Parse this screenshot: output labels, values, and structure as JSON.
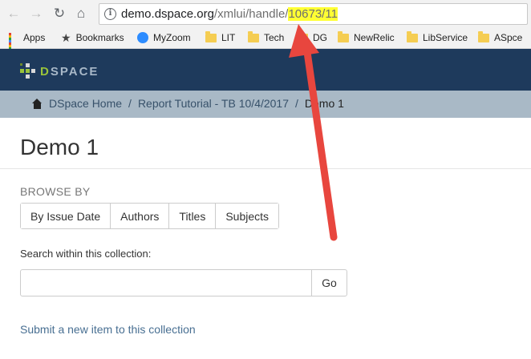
{
  "browser": {
    "url_host": "demo.dspace.org",
    "url_path": "/xmlui/handle/",
    "url_highlight": "10673/11",
    "bookmarks": [
      {
        "label": "Apps",
        "icon": "apps-grid-icon"
      },
      {
        "label": "Bookmarks",
        "icon": "star-icon"
      },
      {
        "label": "MyZoom",
        "icon": "zoom-icon"
      },
      {
        "label": "LIT",
        "icon": "folder-icon"
      },
      {
        "label": "Tech",
        "icon": "folder-icon"
      },
      {
        "label": "DG",
        "icon": "folder-icon"
      },
      {
        "label": "NewRelic",
        "icon": "folder-icon"
      },
      {
        "label": "LibService",
        "icon": "folder-icon"
      },
      {
        "label": "ASpce",
        "icon": "folder-icon"
      }
    ]
  },
  "header": {
    "logo_d": "D",
    "logo_rest": "SPACE"
  },
  "breadcrumb": {
    "home": "DSpace Home",
    "parent": "Report Tutorial - TB 10/4/2017",
    "sep": "/",
    "current": "Demo 1"
  },
  "page": {
    "title": "Demo 1",
    "browse_label": "BROWSE BY",
    "browse_buttons": [
      "By Issue Date",
      "Authors",
      "Titles",
      "Subjects"
    ],
    "search_label": "Search within this collection:",
    "search_value": "",
    "go_label": "Go",
    "submit_link": "Submit a new item to this collection"
  },
  "colors": {
    "header_bg": "#1e3a5c",
    "breadcrumb_bg": "#a9b9c6",
    "annotation_arrow": "#e8463e",
    "url_highlight": "#ffff33"
  }
}
